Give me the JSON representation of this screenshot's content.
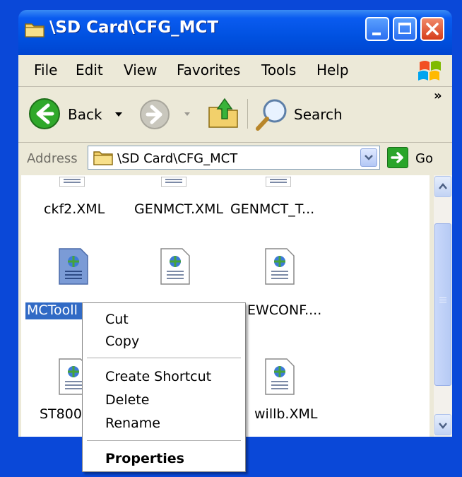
{
  "window": {
    "title": "\\SD Card\\CFG_MCT"
  },
  "menubar": {
    "items": [
      "File",
      "Edit",
      "View",
      "Favorites",
      "Tools",
      "Help"
    ]
  },
  "toolbar": {
    "back_label": "Back",
    "search_label": "Search",
    "overflow": "»"
  },
  "address": {
    "label": "Address",
    "value": "\\SD Card\\CFG_MCT",
    "go_label": "Go"
  },
  "files": [
    {
      "name": "ckf2.XML",
      "selected": false
    },
    {
      "name": "GENMCT.XML",
      "selected": false
    },
    {
      "name": "GENMCT_T...",
      "selected": false
    },
    {
      "name": "MCTooll",
      "selected": true
    },
    {
      "name": "EWCONF....",
      "selected": false
    },
    {
      "name": "ST800",
      "selected": false
    },
    {
      "name": "willb.XML",
      "selected": false
    }
  ],
  "context_menu": {
    "items": [
      "Cut",
      "Copy",
      "Create Shortcut",
      "Delete",
      "Rename",
      "Properties"
    ]
  },
  "colors": {
    "titlebar": "#0054e3",
    "selection": "#316ac5",
    "chrome": "#ece9d8"
  }
}
